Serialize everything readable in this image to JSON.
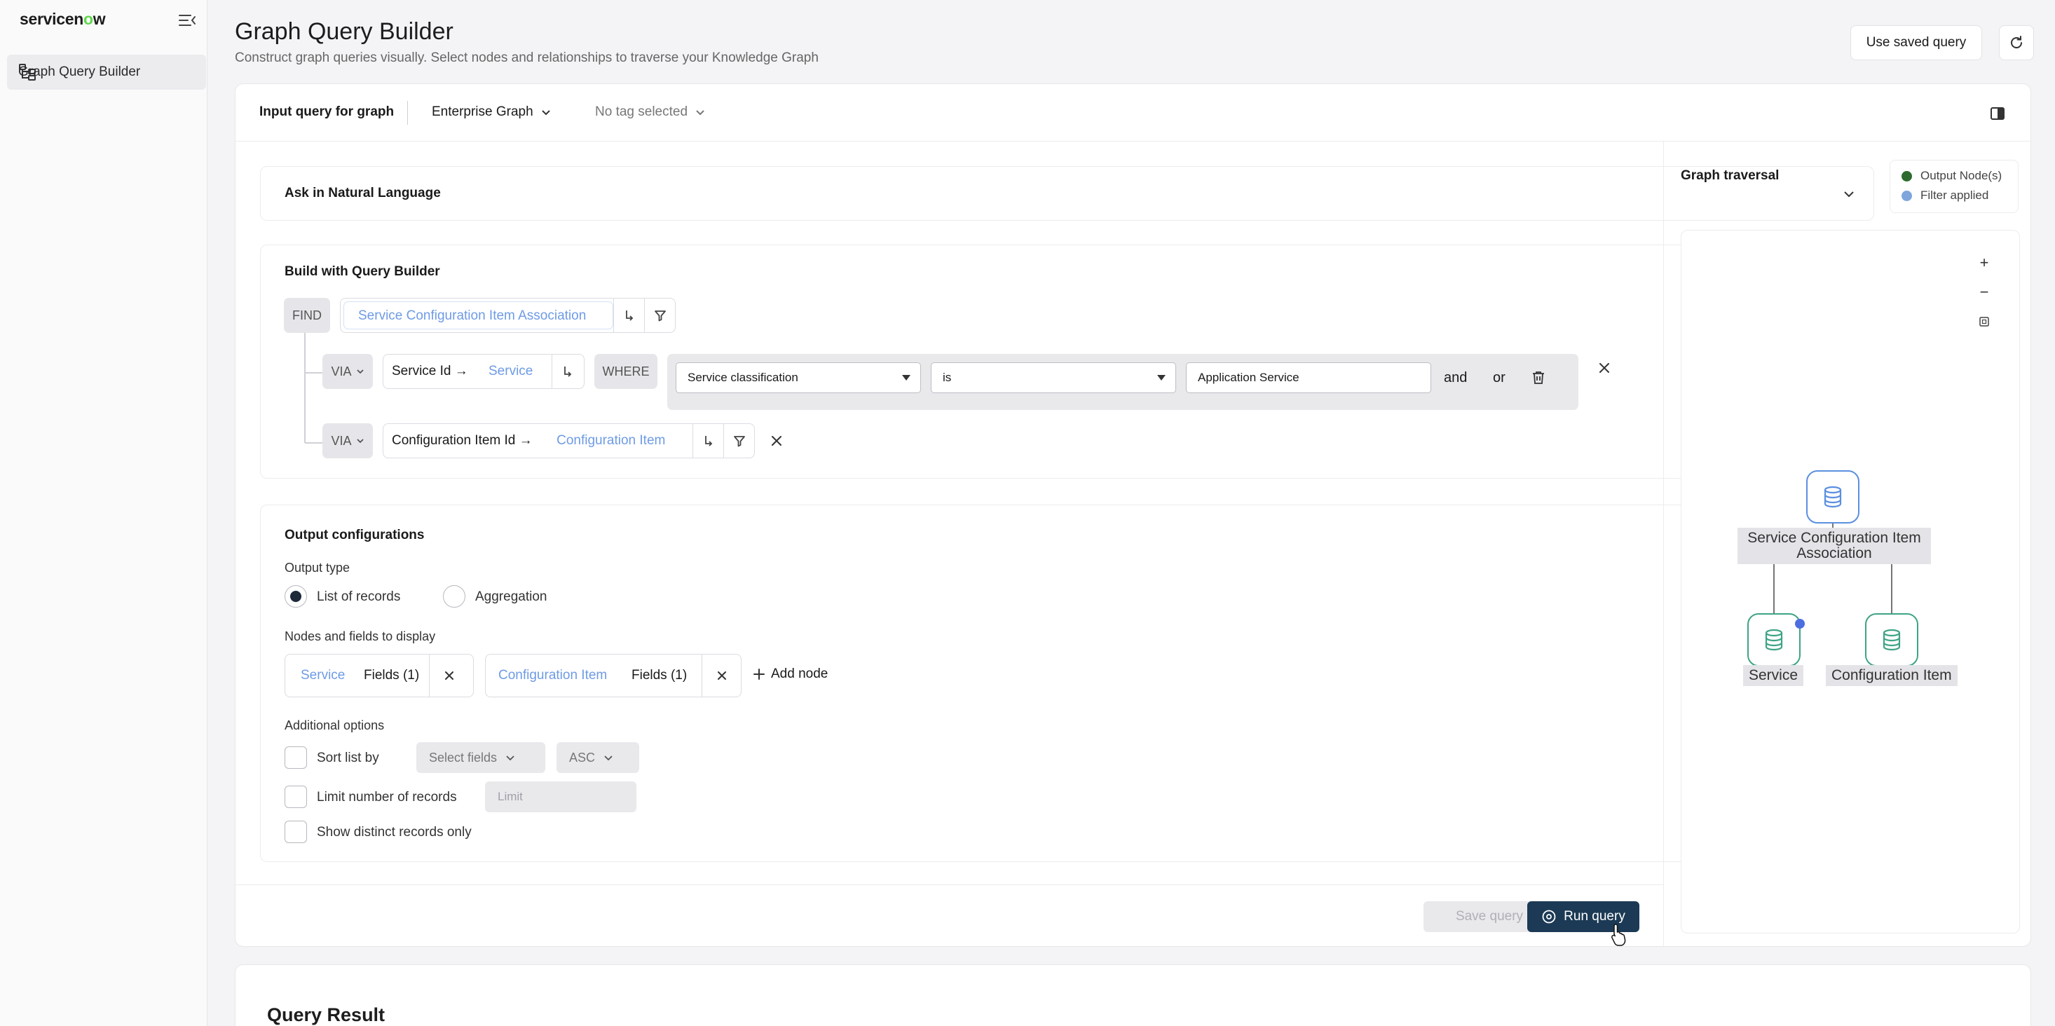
{
  "sidebar": {
    "brand": {
      "text_a": "servicen",
      "text_o": "o",
      "text_b": "w"
    },
    "nav_items": [
      {
        "label": "Graph Query Builder",
        "icon": "tree-structure-icon"
      }
    ]
  },
  "header": {
    "title": "Graph Query Builder",
    "subtitle": "Construct graph queries visually. Select nodes and relationships to traverse your Knowledge Graph",
    "saved_query_label": "Use saved query",
    "refresh_icon": "refresh-icon"
  },
  "card_header": {
    "input_label": "Input query for graph",
    "graph_value": "Enterprise Graph",
    "tag_value": "No tag selected"
  },
  "nl_section": {
    "title": "Ask in Natural Language"
  },
  "builder": {
    "title": "Build with Query Builder",
    "find_label": "FIND",
    "find_node": "Service Configuration Item Association",
    "via1": {
      "label": "VIA",
      "field": "Service Id →",
      "target": "Service",
      "where_label": "WHERE",
      "condition": {
        "field": "Service classification",
        "operator": "is",
        "value": "Application Service",
        "and_label": "and",
        "or_label": "or"
      }
    },
    "via2": {
      "label": "VIA",
      "field": "Configuration Item Id →",
      "target": "Configuration Item"
    }
  },
  "output": {
    "title": "Output configurations",
    "type_label": "Output type",
    "options": [
      {
        "label": "List of records",
        "selected": true
      },
      {
        "label": "Aggregation",
        "selected": false
      }
    ],
    "nodes_label": "Nodes and fields to display",
    "nodes": [
      {
        "name": "Service",
        "fields": "Fields (1)"
      },
      {
        "name": "Configuration Item",
        "fields": "Fields (1)"
      }
    ],
    "add_node_label": "Add node",
    "additional_label": "Additional options",
    "sort_label": "Sort list by",
    "sort_fields_placeholder": "Select fields",
    "sort_order": "ASC",
    "limit_label": "Limit number of records",
    "limit_placeholder": "Limit",
    "distinct_label": "Show distinct records only"
  },
  "footer": {
    "save_label": "Save query",
    "run_label": "Run query"
  },
  "graph": {
    "title": "Graph traversal",
    "legend": [
      {
        "label": "Output Node(s)",
        "color": "#2e6b2e"
      },
      {
        "label": "Filter applied",
        "color": "#7ea6dc"
      }
    ],
    "zoom_in": "+",
    "zoom_out": "−",
    "nodes": [
      {
        "label": "Service Configuration Item Association",
        "role": "root"
      },
      {
        "label": "Service",
        "role": "output",
        "filter": true
      },
      {
        "label": "Configuration Item",
        "role": "output",
        "filter": false
      }
    ],
    "colors": {
      "root": "#5b8fe0",
      "output": "#3fa386"
    }
  },
  "result": {
    "title": "Query Result"
  }
}
